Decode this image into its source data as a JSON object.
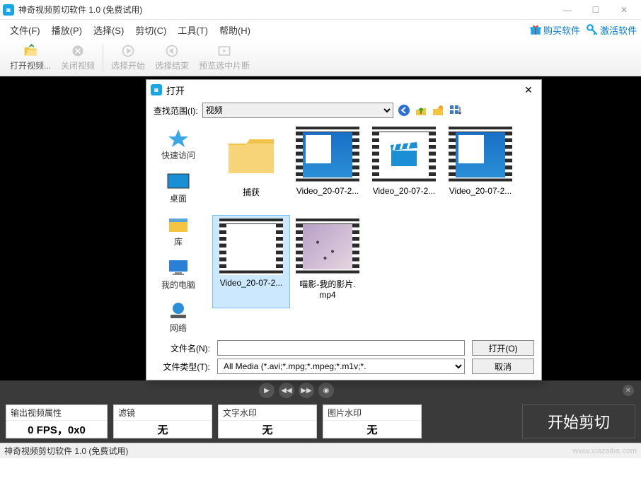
{
  "titlebar": {
    "title": "神奇视频剪切软件 1.0 (免费试用)"
  },
  "menu": {
    "items": [
      "文件(F)",
      "播放(P)",
      "选择(S)",
      "剪切(C)",
      "工具(T)",
      "帮助(H)"
    ],
    "buy": "购买软件",
    "activate": "激活软件"
  },
  "toolbar": {
    "open": "打开视频...",
    "close": "关闭视频",
    "selstart": "选择开始",
    "selend": "选择结束",
    "preview": "预览选中片断"
  },
  "panels": {
    "output_header": "输出视频属性",
    "output_value": "0 FPS，0x0",
    "filter_header": "滤镜",
    "filter_value": "无",
    "text_wm_header": "文字水印",
    "text_wm_value": "无",
    "img_wm_header": "图片水印",
    "img_wm_value": "无",
    "start_cut": "开始剪切"
  },
  "statusbar": {
    "text": "神奇视频剪切软件 1.0 (免费试用)",
    "watermark": "www.xiazaiba.com"
  },
  "dialog": {
    "title": "打开",
    "lookin_label": "查找范围(I):",
    "lookin_value": "视频",
    "places": [
      "快速访问",
      "桌面",
      "库",
      "我的电脑",
      "网络"
    ],
    "files": [
      {
        "name": "捕获",
        "kind": "folder"
      },
      {
        "name": "Video_20-07-2...",
        "kind": "video-desktop"
      },
      {
        "name": "Video_20-07-2...",
        "kind": "video-clap"
      },
      {
        "name": "Video_20-07-2...",
        "kind": "video-desktop"
      },
      {
        "name": "Video_20-07-2...",
        "kind": "video-blank",
        "selected": true
      },
      {
        "name": "喵影-我的影片.",
        "name2": "mp4",
        "kind": "video-photo"
      }
    ],
    "filename_label": "文件名(N):",
    "filename_value": "",
    "filetype_label": "文件类型(T):",
    "filetype_value": "All Media (*.avi;*.mpg;*.mpeg;*.m1v;*.",
    "open_btn": "打开(O)",
    "cancel_btn": "取消"
  }
}
